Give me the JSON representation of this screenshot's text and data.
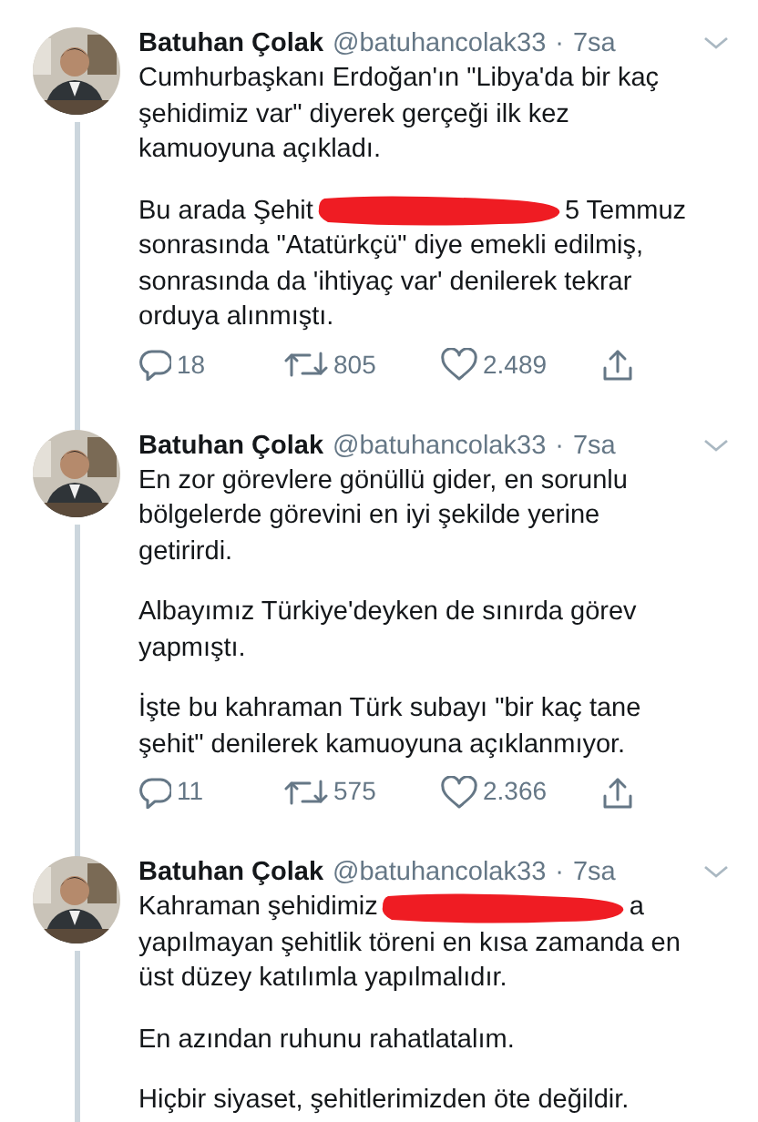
{
  "tweets": [
    {
      "name": "Batuhan Çolak",
      "handle": "@batuhancolak33",
      "separator": "·",
      "time": "7sa",
      "paragraphs": [
        [
          [
            {
              "kind": "text",
              "text": "Cumhurbaşkanı Erdoğan'ın \"Libya'da bir kaç"
            }
          ],
          [
            {
              "kind": "text",
              "text": "şehidimiz var\" diyerek gerçeği ilk kez"
            }
          ],
          [
            {
              "kind": "text",
              "text": "kamuoyuna açıkladı."
            }
          ]
        ],
        [
          [
            {
              "kind": "text",
              "text": "Bu arada Şehit"
            },
            {
              "kind": "redaction"
            },
            {
              "kind": "text",
              "text": "5 Temmuz"
            }
          ],
          [
            {
              "kind": "text",
              "text": "sonrasında \"Atatürkçü\" diye emekli edilmiş,"
            }
          ],
          [
            {
              "kind": "text",
              "text": "sonrasında da 'ihtiyaç var' denilerek tekrar"
            }
          ],
          [
            {
              "kind": "text",
              "text": "orduya alınmıştı."
            }
          ]
        ]
      ],
      "actions": {
        "replies": "18",
        "retweets": "805",
        "likes": "2.489"
      }
    },
    {
      "name": "Batuhan Çolak",
      "handle": "@batuhancolak33",
      "separator": "·",
      "time": "7sa",
      "paragraphs": [
        [
          [
            {
              "kind": "text",
              "text": "En zor görevlere gönüllü gider, en sorunlu"
            }
          ],
          [
            {
              "kind": "text",
              "text": "bölgelerde görevini en iyi şekilde yerine"
            }
          ],
          [
            {
              "kind": "text",
              "text": "getirirdi."
            }
          ]
        ],
        [
          [
            {
              "kind": "text",
              "text": "Albayımız Türkiye'deyken de sınırda görev"
            }
          ],
          [
            {
              "kind": "text",
              "text": "yapmıştı."
            }
          ]
        ],
        [
          [
            {
              "kind": "text",
              "text": "İşte bu kahraman Türk subayı \"bir kaç tane"
            }
          ],
          [
            {
              "kind": "text",
              "text": "şehit\" denilerek kamuoyuna açıklanmıyor."
            }
          ]
        ]
      ],
      "actions": {
        "replies": "11",
        "retweets": "575",
        "likes": "2.366"
      }
    },
    {
      "name": "Batuhan Çolak",
      "handle": "@batuhancolak33",
      "separator": "·",
      "time": "7sa",
      "paragraphs": [
        [
          [
            {
              "kind": "text",
              "text": "Kahraman şehidimiz"
            },
            {
              "kind": "redaction"
            },
            {
              "kind": "text",
              "text": "a"
            }
          ],
          [
            {
              "kind": "text",
              "text": "yapılmayan şehitlik töreni en kısa zamanda en"
            }
          ],
          [
            {
              "kind": "text",
              "text": "üst düzey katılımla yapılmalıdır."
            }
          ]
        ],
        [
          [
            {
              "kind": "text",
              "text": "En azından ruhunu rahatlatalım."
            }
          ]
        ],
        [
          [
            {
              "kind": "text",
              "text": "Hiçbir siyaset, şehitlerimizden öte değildir."
            }
          ]
        ]
      ]
    }
  ]
}
